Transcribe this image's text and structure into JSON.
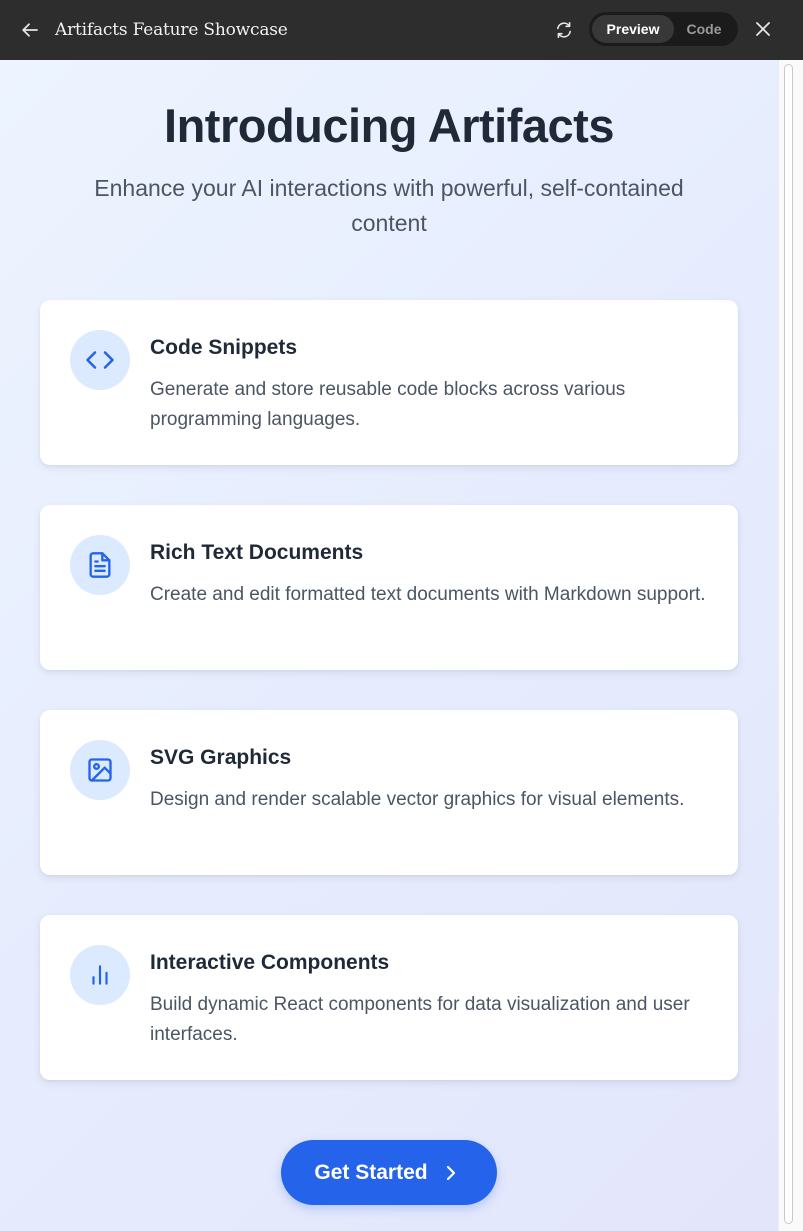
{
  "window": {
    "title": "Artifacts Feature Showcase",
    "back_icon": "arrow-left-icon",
    "refresh_icon": "refresh-icon",
    "close_icon": "close-icon",
    "view_toggle": {
      "options": [
        "Preview",
        "Code"
      ],
      "selected": "Preview"
    }
  },
  "hero": {
    "title": "Introducing Artifacts",
    "subtitle": "Enhance your AI interactions with powerful, self-contained content"
  },
  "features": [
    {
      "icon": "code-icon",
      "title": "Code Snippets",
      "description": "Generate and store reusable code blocks across various programming languages."
    },
    {
      "icon": "document-icon",
      "title": "Rich Text Documents",
      "description": "Create and edit formatted text documents with Markdown support."
    },
    {
      "icon": "image-icon",
      "title": "SVG Graphics",
      "description": "Design and render scalable vector graphics for visual elements."
    },
    {
      "icon": "bar-chart-icon",
      "title": "Interactive Components",
      "description": "Build dynamic React components for data visualization and user interfaces."
    }
  ],
  "cta": {
    "label": "Get Started",
    "icon": "chevron-right-icon"
  },
  "colors": {
    "accent": "#2563eb",
    "icon_bg": "#dbeafe",
    "titlebar": "#2d2d2d",
    "heading": "#1f2937",
    "body_text": "#4b5563"
  }
}
